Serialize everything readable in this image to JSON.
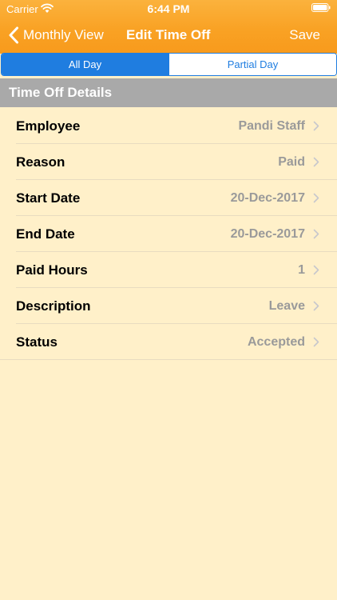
{
  "status_bar": {
    "carrier": "Carrier",
    "time": "6:44 PM"
  },
  "nav": {
    "back_label": "Monthly View",
    "title": "Edit Time Off",
    "save_label": "Save"
  },
  "segments": {
    "all_day": "All Day",
    "partial_day": "Partial Day",
    "selected": "All Day"
  },
  "section": {
    "title": "Time Off Details"
  },
  "rows": [
    {
      "label": "Employee",
      "value": "Pandi Staff"
    },
    {
      "label": "Reason",
      "value": "Paid"
    },
    {
      "label": "Start Date",
      "value": "20-Dec-2017"
    },
    {
      "label": "End Date",
      "value": "20-Dec-2017"
    },
    {
      "label": "Paid Hours",
      "value": "1"
    },
    {
      "label": "Description",
      "value": "Leave"
    },
    {
      "label": "Status",
      "value": "Accepted"
    }
  ],
  "colors": {
    "header_orange": "#f9a224",
    "accent_blue": "#1f7de0",
    "background": "#fff0c9",
    "section_gray": "#a9a9a9",
    "value_gray": "#9a9a9a"
  },
  "icons": {
    "wifi": "wifi-icon",
    "battery": "battery-icon",
    "back": "chevron-left-icon",
    "disclosure": "chevron-right-icon"
  }
}
